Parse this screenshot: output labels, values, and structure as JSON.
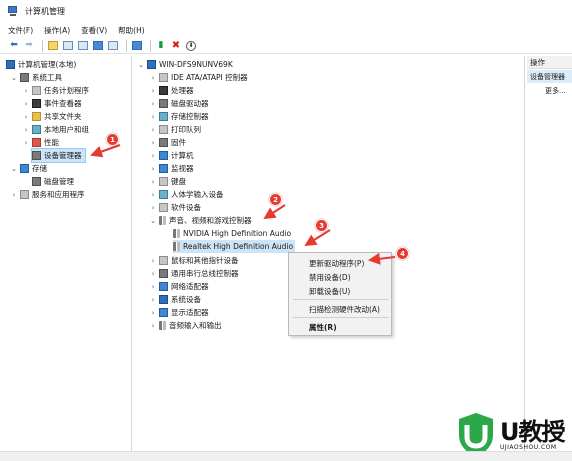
{
  "window": {
    "title": "计算机管理"
  },
  "menu": [
    "文件(F)",
    "操作(A)",
    "查看(V)",
    "帮助(H)"
  ],
  "toolbar_icons": [
    "back-arrow-icon",
    "forward-arrow-icon",
    "folder-up-icon",
    "console-tree-icon",
    "properties-icon",
    "help-icon",
    "panel-icon",
    "monitor-icon",
    "enable-device-icon",
    "delete-icon",
    "download-icon"
  ],
  "left_tree": {
    "root": "计算机管理(本地)",
    "system_tools": "系统工具",
    "task_scheduler": "任务计划程序",
    "event_viewer": "事件查看器",
    "shared_folders": "共享文件夹",
    "local_users": "本地用户和组",
    "performance": "性能",
    "device_manager": "设备管理器",
    "storage": "存储",
    "disk_management": "磁盘管理",
    "services_apps": "服务和应用程序"
  },
  "device_tree": {
    "computer": "WIN-DFS9NUNV69K",
    "categories": [
      "IDE ATA/ATAPI 控制器",
      "处理器",
      "磁盘驱动器",
      "存储控制器",
      "打印队列",
      "固件",
      "计算机",
      "监视器",
      "键盘",
      "人体学输入设备",
      "软件设备",
      "声音、视频和游戏控制器"
    ],
    "sound_children": [
      "NVIDIA High Definition Audio",
      "Realtek High Definition Audio"
    ],
    "after": [
      "鼠标和其他指针设备",
      "通用串行总线控制器",
      "网络适配器",
      "系统设备",
      "显示适配器",
      "音频输入和输出"
    ]
  },
  "context_menu": {
    "update_driver": "更新驱动程序(P)",
    "disable_device": "禁用设备(D)",
    "uninstall_device": "卸载设备(U)",
    "scan_hardware": "扫描检测硬件改动(A)",
    "properties": "属性(R)"
  },
  "actions_pane": {
    "header": "操作",
    "section": "设备管理器",
    "more": "更多..."
  },
  "badges": [
    "1",
    "2",
    "3",
    "4"
  ],
  "logo": {
    "text": "U教授",
    "url": "UJIAOSHOU.COM"
  },
  "colors": {
    "accent": "#3b78c2",
    "selection": "#cce4f7",
    "badge": "#e53a2f",
    "logo_green": "#2aa84a"
  }
}
